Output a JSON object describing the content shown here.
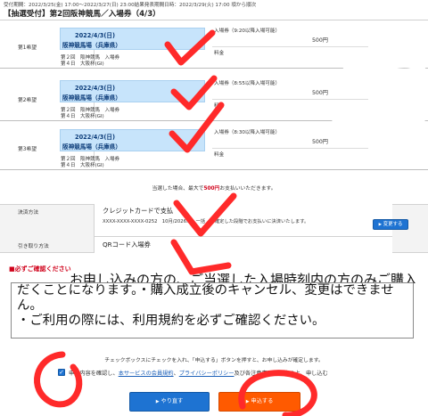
{
  "header": {
    "period": "受付期間：2022/3/25(金) 17:00～2022/3/27(日) 23:00結果発表期間日時：2022/3/29(火) 17:00 頃から順次",
    "title": "【抽選受付】第2回阪神競馬／入場券（4/3）"
  },
  "wishes": [
    {
      "label": "第1希望",
      "date": "2022/4/3(日)",
      "venue": "阪神競馬場（兵庫県）",
      "race_line1": "第２回　阪神競馬　入場券",
      "race_line2": "第４日　大阪杯(GⅠ)",
      "ticket": "入場券（9:20以降入場可能）",
      "fee_label": "料金",
      "price": "500円"
    },
    {
      "label": "第2希望",
      "date": "2022/4/3(日)",
      "venue": "阪神競馬場（兵庫県）",
      "race_line1": "第２回　阪神競馬　入場券",
      "race_line2": "第４日　大阪杯(GⅠ)",
      "ticket": "入場券（8:55以降入場可能）",
      "fee_label": "料金",
      "price": "500円"
    },
    {
      "label": "第3希望",
      "date": "2022/4/3(日)",
      "venue": "阪神競馬場（兵庫県）",
      "race_line1": "第２回　阪神競馬　入場券",
      "race_line2": "第４日　大阪杯(GⅠ)",
      "ticket": "入場券（8:30以降入場可能）",
      "fee_label": "料金",
      "price": "500円"
    }
  ],
  "summary": {
    "max_pre": "当選した場合、最大で",
    "max_amount": "500円",
    "max_post": "お支払いいただきます。"
  },
  "payment": {
    "label": "決済方法",
    "method": "クレジットカードで支払",
    "card": "XXXX-XXXX-XXXX-0252　10月/2026年　一括",
    "card_note": "が確定した段階でお支払いに決済いたします。",
    "change_label": "変更する",
    "pickup_label": "引き取り方法",
    "pickup_value": "QRコード入場券"
  },
  "confirm": {
    "heading": "■必ずご確認ください",
    "top_line": "お申し込みの方の、ご当選した入場時刻内の方のみご購入いた",
    "box_text": "だくことになります。・購入成立後のキャンセル、変更はできません。\n・ご利用の際には、利用規約を必ずご確認ください。"
  },
  "agree": {
    "instruction": "チェックボックスにチェックを入れ、「申込する」ボタンを押すと、お申し込みが確定します。",
    "check_glyph": "✓",
    "pre": "申込内容を確認し、",
    "link1": "本サービスの会員規約",
    "sep": "、",
    "link2": "プライバシーポリシー",
    "post": "及び各注意事項に同意の上、申し込む"
  },
  "buttons": {
    "redo": "やり直す",
    "apply": "申込する",
    "arrow": "▶"
  },
  "colors": {
    "race_box": "#c7e4fb",
    "link_blue": "#1b5fb8",
    "button_blue": "#1e73d2",
    "button_orange": "#ff5a00",
    "alert_red": "#d0021b",
    "marker_red": "#ff2a2a"
  }
}
